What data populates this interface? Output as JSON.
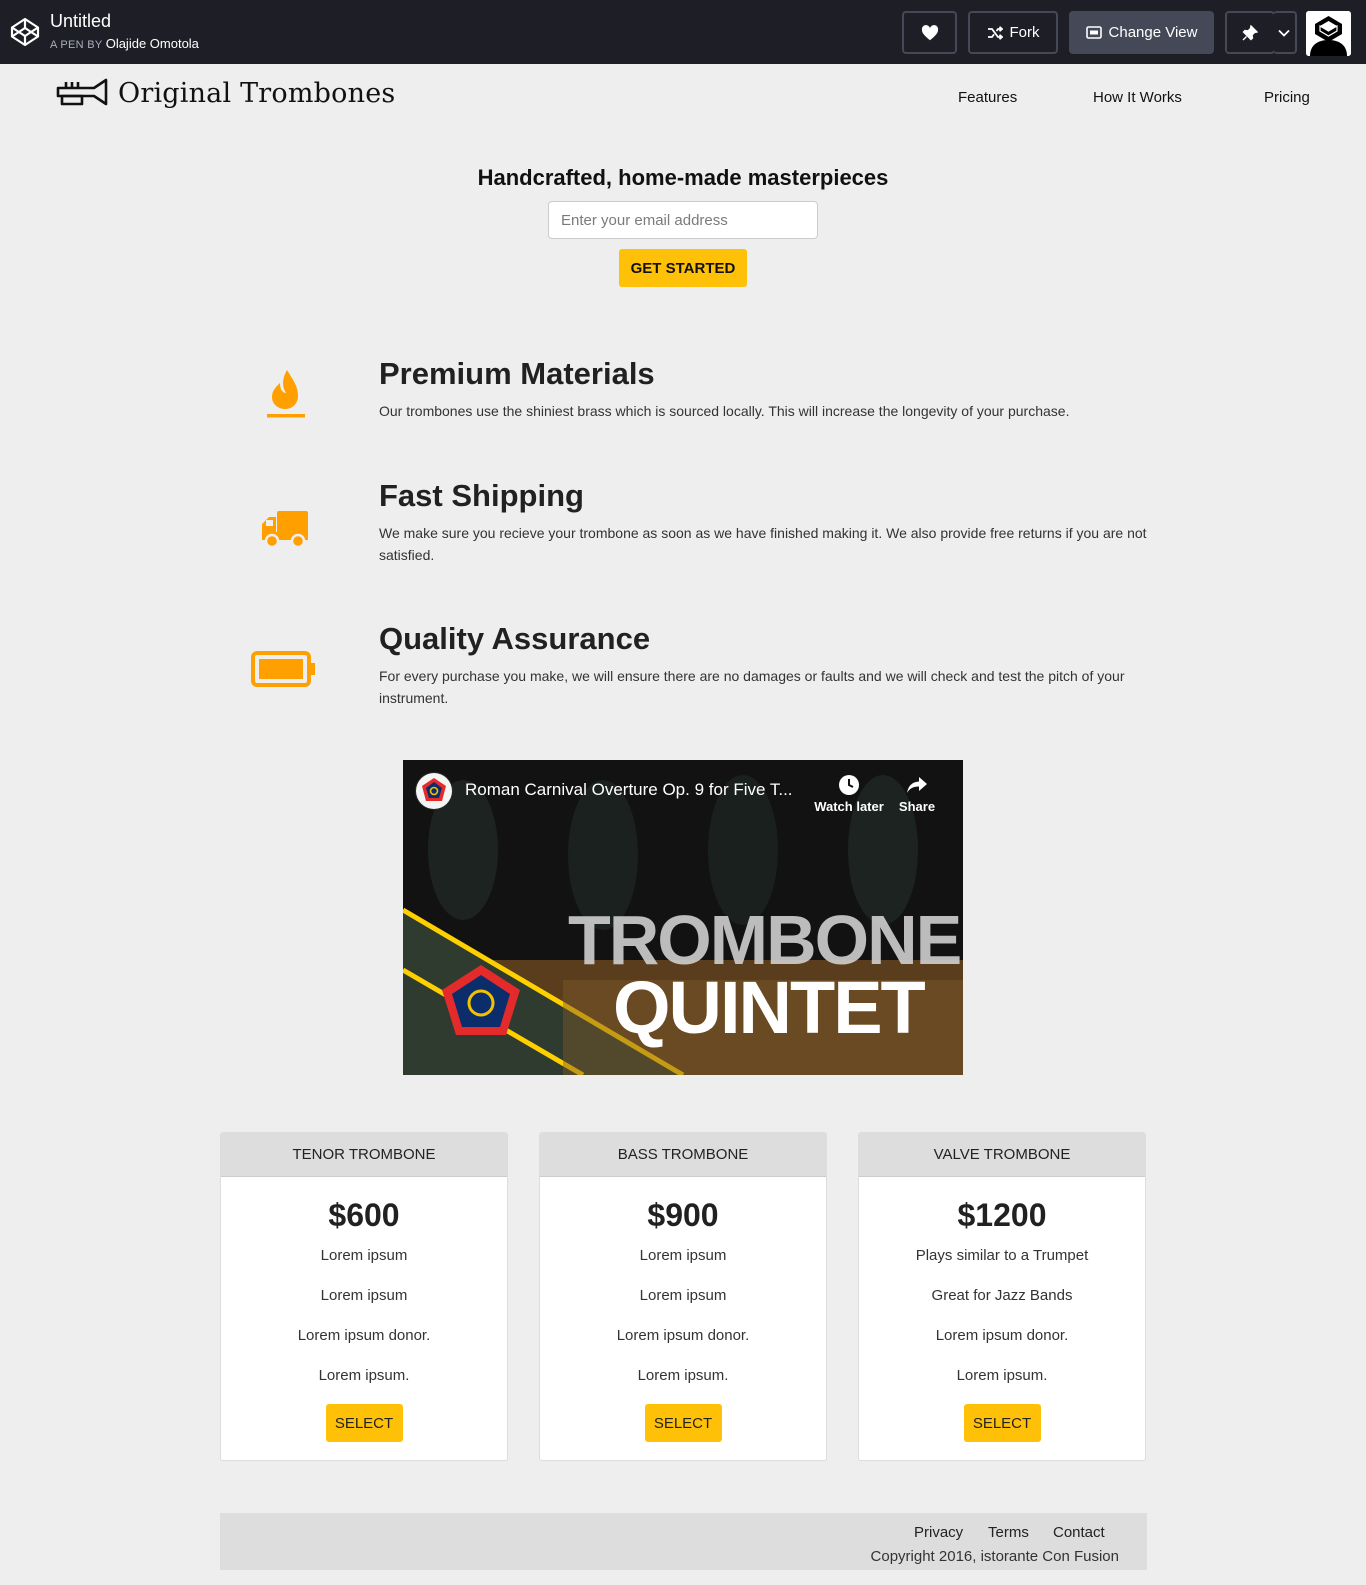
{
  "codepen": {
    "title": "Untitled",
    "byline_prefix": "A PEN BY",
    "author": "Olajide Omotola",
    "fork_label": "Fork",
    "change_view_label": "Change View"
  },
  "nav": {
    "brand": "Original Trombones",
    "links": [
      "Features",
      "How It Works",
      "Pricing"
    ]
  },
  "hero": {
    "title": "Handcrafted, home-made masterpieces",
    "email_placeholder": "Enter your email address",
    "cta_label": "GET STARTED"
  },
  "features": [
    {
      "icon": "fire-icon",
      "title": "Premium Materials",
      "description": "Our trombones use the shiniest brass which is sourced locally. This will increase the longevity of your purchase."
    },
    {
      "icon": "truck-icon",
      "title": "Fast Shipping",
      "description": "We make sure you recieve your trombone as soon as we have finished making it. We also provide free returns if you are not satisfied."
    },
    {
      "icon": "battery-icon",
      "title": "Quality Assurance",
      "description": "For every purchase you make, we will ensure there are no damages or faults and we will check and test the pitch of your instrument."
    }
  ],
  "video": {
    "title": "Roman Carnival Overture Op. 9 for Five T...",
    "watch_later": "Watch later",
    "share": "Share",
    "overlay_line1": "TROMBONE",
    "overlay_line2": "QUINTET"
  },
  "pricing": [
    {
      "name": "TENOR TROMBONE",
      "price": "$600",
      "features": [
        "Lorem ipsum",
        "Lorem ipsum",
        "Lorem ipsum donor.",
        "Lorem ipsum."
      ],
      "button": "SELECT"
    },
    {
      "name": "BASS TROMBONE",
      "price": "$900",
      "features": [
        "Lorem ipsum",
        "Lorem ipsum",
        "Lorem ipsum donor.",
        "Lorem ipsum."
      ],
      "button": "SELECT"
    },
    {
      "name": "VALVE TROMBONE",
      "price": "$1200",
      "features": [
        "Plays similar to a Trumpet",
        "Great for Jazz Bands",
        "Lorem ipsum donor.",
        "Lorem ipsum."
      ],
      "button": "SELECT"
    }
  ],
  "footer": {
    "links": [
      "Privacy",
      "Terms",
      "Contact"
    ],
    "copyright": "Copyright 2016, istorante Con Fusion"
  },
  "colors": {
    "accent": "#ffc107",
    "icon": "#ffa000",
    "codepen_bar": "#1e1f26"
  }
}
